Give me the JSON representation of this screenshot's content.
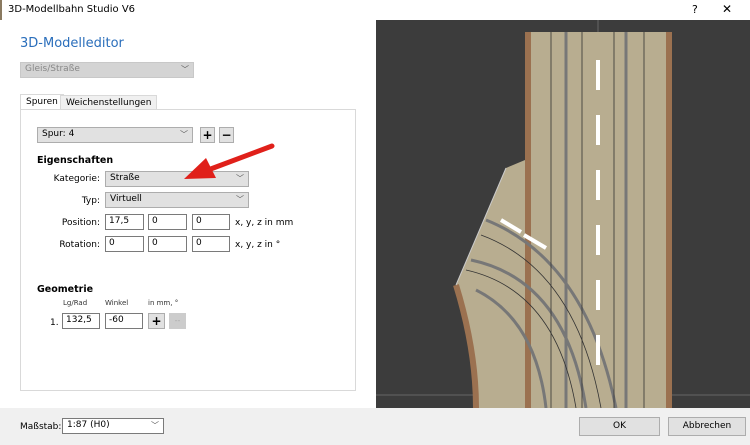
{
  "window": {
    "title": "3D-Modellbahn Studio V6",
    "help": "?",
    "close": "✕"
  },
  "editor": {
    "heading": "3D-Modelleditor",
    "type_select": "Gleis/Straße",
    "tabs": [
      {
        "label": "Spuren",
        "active": true
      },
      {
        "label": "Weichenstellungen",
        "active": false
      }
    ],
    "track_select": "Spur: 4",
    "add": "+",
    "remove": "−",
    "properties": {
      "title": "Eigenschaften",
      "kategorie_label": "Kategorie:",
      "kategorie": "Straße",
      "typ_label": "Typ:",
      "typ": "Virtuell",
      "position_label": "Position:",
      "position": [
        "17,5",
        "0",
        "0"
      ],
      "position_unit": "x, y, z in mm",
      "rotation_label": "Rotation:",
      "rotation": [
        "0",
        "0",
        "0"
      ],
      "rotation_unit": "x, y, z in °"
    },
    "geometry": {
      "title": "Geometrie",
      "col_length": "Lg/Rad",
      "col_angle": "Winkel",
      "col_unit": "in mm, °",
      "rows": [
        {
          "index": "1.",
          "length": "132,5",
          "angle": "-60"
        }
      ],
      "add": "+",
      "remove": "--"
    }
  },
  "footer": {
    "scale_label": "Maßstab:",
    "scale": "1:87 (H0)",
    "ok": "OK",
    "cancel": "Abbrechen"
  },
  "colors": {
    "accent": "#2a6ebb",
    "viewport_bg": "#3c3c3c",
    "road": "#b8ad90",
    "road_edge": "#9b7150",
    "arrow": "#e0201a"
  }
}
